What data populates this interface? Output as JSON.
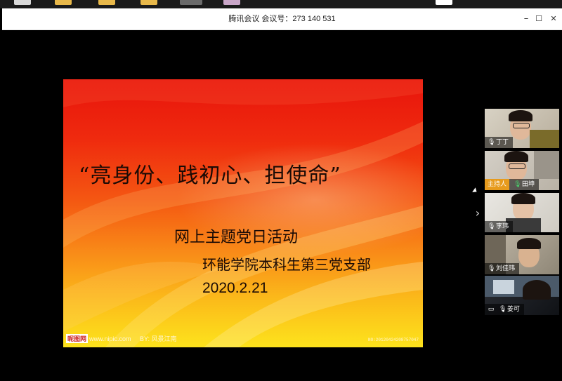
{
  "window": {
    "title": "腾讯会议 会议号：273 140 531",
    "minimize_icon": "minimize-icon",
    "maximize_icon": "maximize-icon",
    "close_icon": "close-icon",
    "minimize_glyph": "–",
    "maximize_glyph": "☐",
    "close_glyph": "✕"
  },
  "slide": {
    "title": "“亮身份、践初心、担使命”",
    "subtitle": "网上主题党日活动",
    "organization": "环能学院本科生第三党支部",
    "date": "2020.2.21",
    "watermark_logo": "昵图网",
    "watermark_site": "www.nipic.com",
    "watermark_author": "BY: 风景江南",
    "watermark_id": "NO:20120424208757047"
  },
  "panel": {
    "collapse_glyph": "›",
    "participants": [
      {
        "name": "丁丁",
        "mic_icon": "mic-icon",
        "mic_color": "#ffffff",
        "host": false
      },
      {
        "name": "田坤",
        "mic_icon": "mic-active-icon",
        "mic_color": "#49d36b",
        "host": true,
        "host_label": "主持人"
      },
      {
        "name": "李玮",
        "mic_icon": "mic-muted-icon",
        "mic_color": "#ffffff",
        "host": false
      },
      {
        "name": "刘佳玮",
        "mic_icon": "mic-muted-icon",
        "mic_color": "#ffffff",
        "host": false
      },
      {
        "name": "姜可",
        "mic_icon": "mic-muted-icon",
        "mic_color": "#ffffff",
        "host": false
      }
    ]
  },
  "colors": {
    "slide_top": "#e8140c",
    "slide_bottom": "#fde31c",
    "host_badge": "#e79b1d",
    "active_mic": "#49d36b"
  }
}
